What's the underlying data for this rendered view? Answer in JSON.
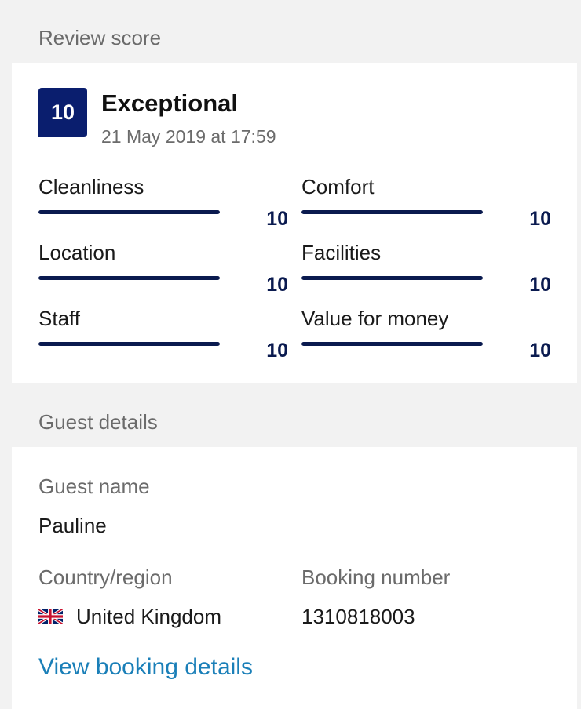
{
  "review": {
    "section_title": "Review score",
    "score": "10",
    "verdict": "Exceptional",
    "date": "21 May 2019 at 17:59",
    "categories": [
      {
        "label": "Cleanliness",
        "value": "10",
        "fraction": 1.0
      },
      {
        "label": "Comfort",
        "value": "10",
        "fraction": 1.0
      },
      {
        "label": "Location",
        "value": "10",
        "fraction": 1.0
      },
      {
        "label": "Facilities",
        "value": "10",
        "fraction": 1.0
      },
      {
        "label": "Staff",
        "value": "10",
        "fraction": 1.0
      },
      {
        "label": "Value for money",
        "value": "10",
        "fraction": 1.0
      }
    ],
    "colors": {
      "badge": "#0a1e6e",
      "bar": "#0a1a4f"
    }
  },
  "guest": {
    "section_title": "Guest details",
    "name_label": "Guest name",
    "name": "Pauline",
    "country_label": "Country/region",
    "country": "United Kingdom",
    "country_flag_icon": "uk-flag-icon",
    "booking_label": "Booking number",
    "booking_number": "1310818003",
    "link": "View booking details",
    "link_color": "#1a7fb8"
  }
}
